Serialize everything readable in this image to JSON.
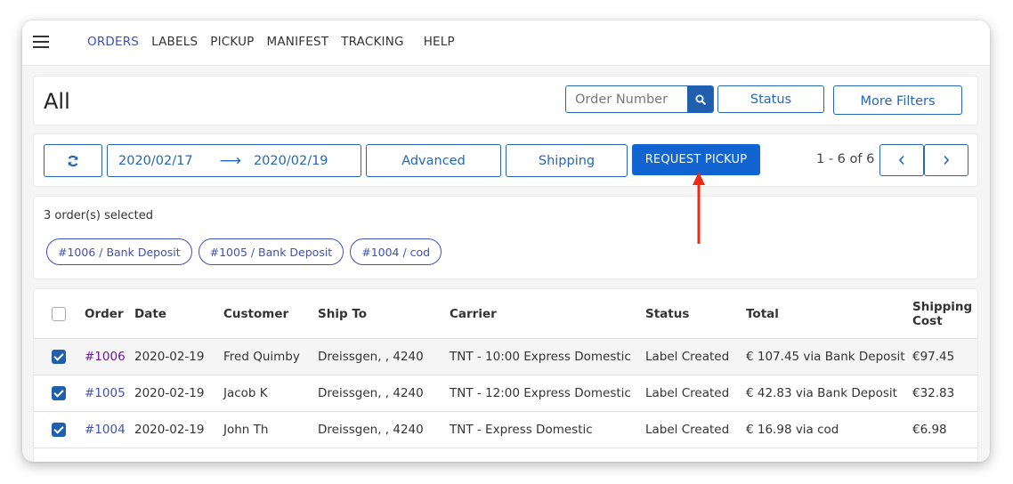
{
  "nav": {
    "items": [
      {
        "label": "ORDERS",
        "active": true
      },
      {
        "label": "LABELS"
      },
      {
        "label": "PICKUP"
      },
      {
        "label": "MANIFEST"
      },
      {
        "label": "TRACKING"
      },
      {
        "label": "HELP"
      }
    ]
  },
  "header": {
    "title": "All",
    "search_placeholder": "Order Number",
    "status_label": "Status",
    "more_filters_label": "More Filters"
  },
  "toolbar": {
    "date_from": "2020/02/17",
    "date_arrow": "⟶",
    "date_to": "2020/02/19",
    "advanced_label": "Advanced",
    "shipping_label": "Shipping",
    "request_pickup_label": "REQUEST PICKUP",
    "pager_text": "1 - 6 of 6",
    "prev_glyph": "‹",
    "next_glyph": "›"
  },
  "selection": {
    "summary": "3 order(s) selected",
    "chips": [
      "#1006 / Bank Deposit",
      "#1005 / Bank Deposit",
      "#1004 / cod"
    ]
  },
  "table": {
    "columns": [
      "Order",
      "Date",
      "Customer",
      "Ship To",
      "Carrier",
      "Status",
      "Total",
      "Shipping Cost"
    ],
    "shipping_cost_header": [
      "Shipping",
      "Cost"
    ],
    "rows": [
      {
        "checked": true,
        "order": "#1006",
        "date": "2020-02-19",
        "customer": "Fred Quimby",
        "ship_to": "Dreissgen, , 4240",
        "carrier": "TNT - 10:00 Express Domestic",
        "status": "Label Created",
        "total": "€ 107.45 via Bank Deposit",
        "shipping_cost": "€97.45"
      },
      {
        "checked": true,
        "order": "#1005",
        "date": "2020-02-19",
        "customer": "Jacob K",
        "ship_to": "Dreissgen, , 4240",
        "carrier": "TNT - 12:00 Express Domestic",
        "status": "Label Created",
        "total": "€ 42.83 via Bank Deposit",
        "shipping_cost": "€32.83"
      },
      {
        "checked": true,
        "order": "#1004",
        "date": "2020-02-19",
        "customer": "John Th",
        "ship_to": "Dreissgen, , 4240",
        "carrier": "TNT - Express Domestic",
        "status": "Label Created",
        "total": "€ 16.98 via cod",
        "shipping_cost": "€6.98"
      }
    ]
  },
  "colors": {
    "primary": "#1264d0",
    "outline": "#2566b8",
    "nav_active": "#3f51b5",
    "annotation_arrow": "#f02a12"
  }
}
